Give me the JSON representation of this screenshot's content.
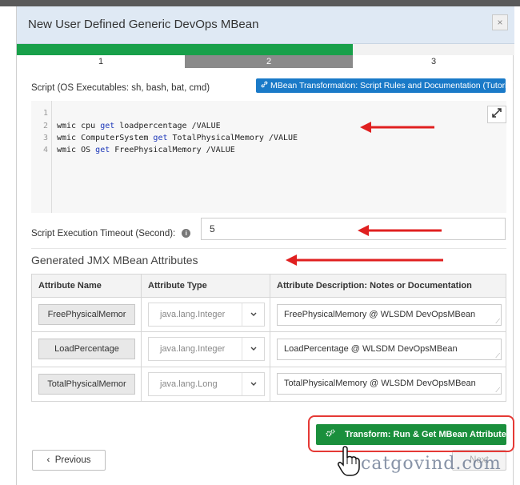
{
  "modal": {
    "title": "New User Defined Generic DevOps MBean",
    "close_glyph": "×"
  },
  "steps": [
    {
      "label": "1"
    },
    {
      "label": "2"
    },
    {
      "label": "3"
    }
  ],
  "script": {
    "label": "Script (OS Executables: sh, bash, bat, cmd)",
    "tutorial_button": "MBean Transformation: Script Rules and Documentation (Tutorial)",
    "line_numbers": [
      "1",
      "2",
      "3",
      "4"
    ],
    "lines": [
      {
        "cmd": "wmic cpu ",
        "kw": "get",
        "rest": " loadpercentage /VALUE"
      },
      {
        "cmd": "wmic ComputerSystem ",
        "kw": "get",
        "rest": " TotalPhysicalMemory /VALUE"
      },
      {
        "cmd": "wmic OS ",
        "kw": "get",
        "rest": " FreePhysicalMemory /VALUE"
      }
    ]
  },
  "timeout": {
    "label": "Script Execution Timeout (Second):",
    "value": "5"
  },
  "attributes": {
    "title": "Generated JMX MBean Attributes",
    "headers": [
      "Attribute Name",
      "Attribute Type",
      "Attribute Description: Notes or Documentation"
    ],
    "rows": [
      {
        "name": "FreePhysicalMemor",
        "type": "java.lang.Integer",
        "description": "FreePhysicalMemory @ WLSDM DevOpsMBean"
      },
      {
        "name": "LoadPercentage",
        "type": "java.lang.Integer",
        "description": "LoadPercentage @ WLSDM DevOpsMBean"
      },
      {
        "name": "TotalPhysicalMemor",
        "type": "java.lang.Long",
        "description": "TotalPhysicalMemory @ WLSDM DevOpsMBean"
      }
    ]
  },
  "footer": {
    "previous_label": "Previous",
    "transform_label": "Transform: Run & Get MBean Attributes",
    "next_label": "Next"
  },
  "watermark": "catgovind.com",
  "colors": {
    "progress_done": "#18a04a",
    "tutorial_button": "#1a7ac8",
    "transform_button": "#1a8f3c",
    "highlight_red": "#e53935"
  },
  "icons": {
    "link": "link-icon",
    "expand": "expand-icon",
    "info": "info-icon",
    "chevron": "chevron-down-icon",
    "cog": "cogs-icon",
    "cursor": "hand-pointer-icon"
  }
}
